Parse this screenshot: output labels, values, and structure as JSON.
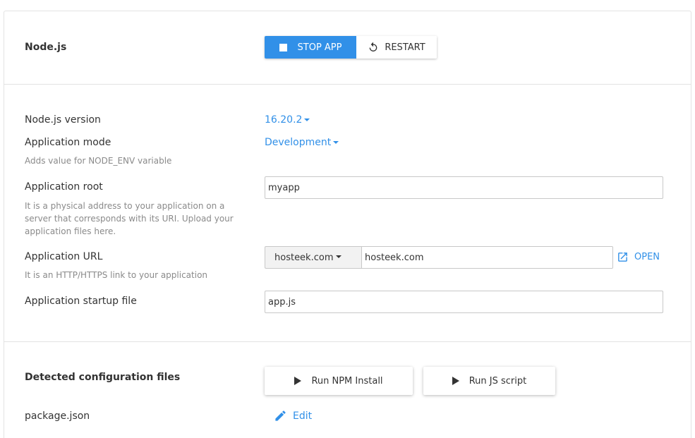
{
  "section_app": {
    "title": "Node.js",
    "stop_label": "STOP APP",
    "restart_label": "RESTART"
  },
  "settings": {
    "version_label": "Node.js version",
    "version_value": "16.20.2",
    "mode_label": "Application mode",
    "mode_value": "Development",
    "mode_hint": "Adds value for NODE_ENV variable",
    "root_label": "Application root",
    "root_value": "myapp",
    "root_hint": "It is a physical address to your application on a server that corresponds with its URI. Upload your application files here.",
    "url_label": "Application URL",
    "url_domain": "hosteek.com",
    "url_value": "hosteek.com",
    "url_hint": "It is an HTTP/HTTPS link to your application",
    "open_label": "OPEN",
    "startup_label": "Application startup file",
    "startup_value": "app.js"
  },
  "config": {
    "title": "Detected configuration files",
    "npm_install_label": "Run NPM Install",
    "run_js_label": "Run JS script",
    "file_name": "package.json",
    "edit_label": "Edit"
  },
  "colors": {
    "accent": "#3190e8",
    "border": "#e3e3e3"
  },
  "icons": {
    "stop": "stop-square-icon",
    "restart": "restart-icon",
    "open": "external-link-icon",
    "run": "play-icon",
    "edit": "pencil-icon"
  }
}
